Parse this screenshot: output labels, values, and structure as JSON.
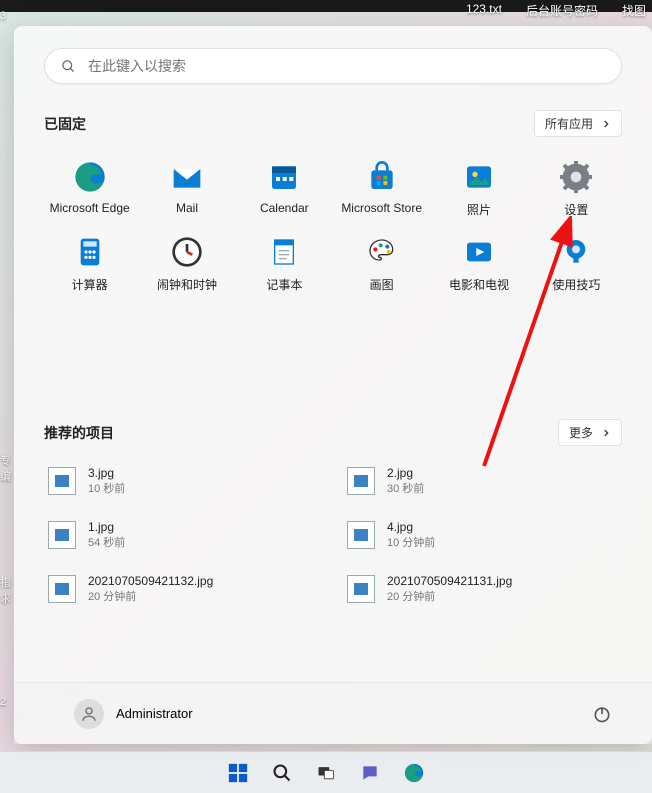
{
  "desktop": {
    "topIcons": [
      "123.txt",
      "后台账号密码",
      "找图"
    ],
    "leftEdge": [
      "3",
      "专编",
      "指求",
      "2"
    ]
  },
  "search": {
    "placeholder": "在此键入以搜索"
  },
  "pinned": {
    "title": "已固定",
    "all_apps_label": "所有应用",
    "apps": [
      {
        "label": "Microsoft Edge",
        "icon": "edge-icon"
      },
      {
        "label": "Mail",
        "icon": "mail-icon"
      },
      {
        "label": "Calendar",
        "icon": "calendar-icon"
      },
      {
        "label": "Microsoft Store",
        "icon": "store-icon"
      },
      {
        "label": "照片",
        "icon": "photos-icon"
      },
      {
        "label": "设置",
        "icon": "settings-icon"
      },
      {
        "label": "计算器",
        "icon": "calculator-icon"
      },
      {
        "label": "闹钟和时钟",
        "icon": "clock-icon"
      },
      {
        "label": "记事本",
        "icon": "notepad-icon"
      },
      {
        "label": "画图",
        "icon": "paint-icon"
      },
      {
        "label": "电影和电视",
        "icon": "movies-icon"
      },
      {
        "label": "使用技巧",
        "icon": "tips-icon"
      }
    ]
  },
  "recommended": {
    "title": "推荐的项目",
    "more_label": "更多",
    "items": [
      {
        "name": "3.jpg",
        "time": "10 秒前"
      },
      {
        "name": "2.jpg",
        "time": "30 秒前"
      },
      {
        "name": "1.jpg",
        "time": "54 秒前"
      },
      {
        "name": "4.jpg",
        "time": "10 分钟前"
      },
      {
        "name": "2021070509421132.jpg",
        "time": "20 分钟前"
      },
      {
        "name": "2021070509421131.jpg",
        "time": "20 分钟前"
      }
    ]
  },
  "footer": {
    "user": "Administrator"
  },
  "annotation": {
    "arrow_target": "设置"
  }
}
